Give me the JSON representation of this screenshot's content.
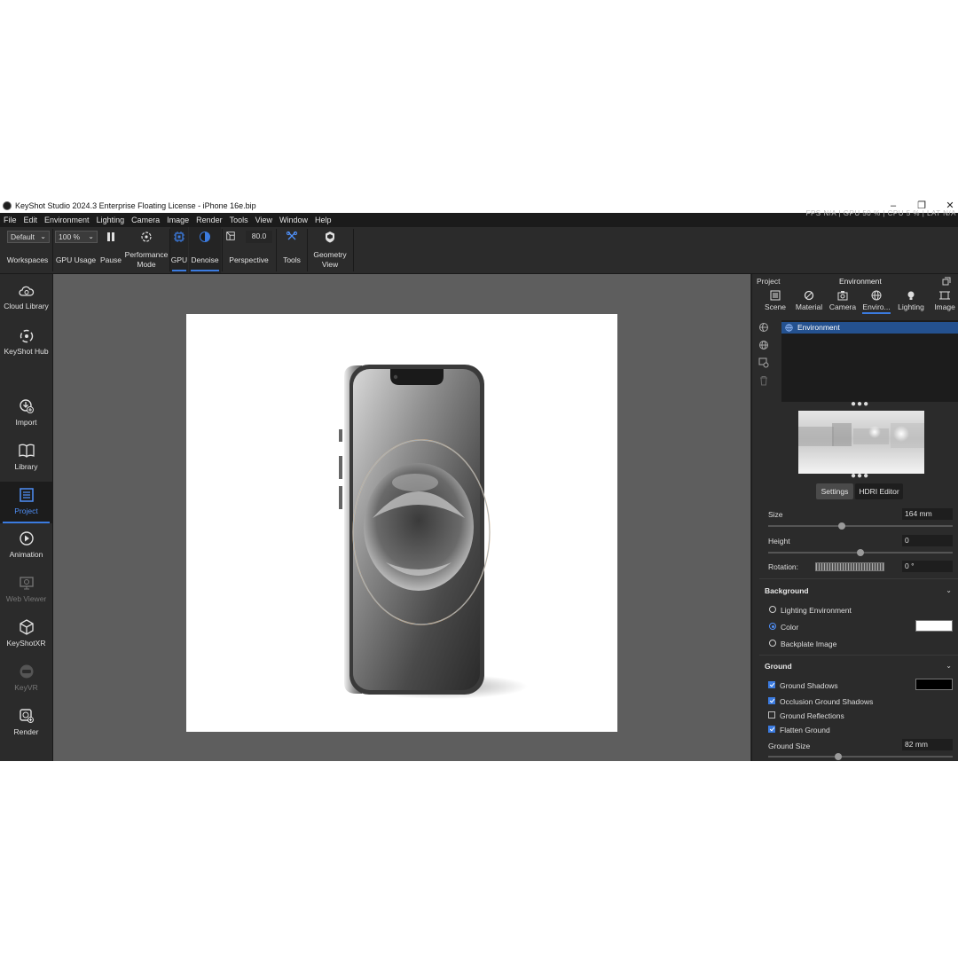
{
  "window": {
    "title": "KeyShot Studio 2024.3 Enterprise Floating License  - iPhone 16e.bip",
    "minimize": "–",
    "restore": "❐",
    "close": "✕"
  },
  "menu": [
    "File",
    "Edit",
    "Environment",
    "Lighting",
    "Camera",
    "Image",
    "Render",
    "Tools",
    "View",
    "Window",
    "Help"
  ],
  "status_text": "FPS N/A  |  GPU 50 %  |  CPU 5 %  |  LAT N/A",
  "toolbar": {
    "workspace_value": "Default",
    "workspaces_label": "Workspaces",
    "gpu_usage_value": "100 %",
    "gpu_usage_label": "GPU Usage",
    "pause_label": "Pause",
    "performance_label": "Performance Mode",
    "gpu_label": "GPU",
    "denoise_label": "Denoise",
    "fov_value": "80.0",
    "perspective_label": "Perspective",
    "tools_label": "Tools",
    "geometry_label": "Geometry View"
  },
  "sidebar": [
    {
      "label": "Cloud Library",
      "icon": "cloud-library-icon"
    },
    {
      "label": "KeyShot Hub",
      "icon": "keyshot-hub-icon"
    },
    {
      "label": "Import",
      "icon": "import-icon"
    },
    {
      "label": "Library",
      "icon": "library-icon"
    },
    {
      "label": "Project",
      "icon": "project-icon"
    },
    {
      "label": "Animation",
      "icon": "animation-icon"
    },
    {
      "label": "Web Viewer",
      "icon": "web-viewer-icon"
    },
    {
      "label": "KeyShotXR",
      "icon": "keyshotxr-icon"
    },
    {
      "label": "KeyVR",
      "icon": "keyvr-icon"
    },
    {
      "label": "Render",
      "icon": "render-icon"
    }
  ],
  "panel": {
    "project_label": "Project",
    "title": "Environment",
    "tabs": [
      "Scene",
      "Material",
      "Camera",
      "Enviro...",
      "Lighting",
      "Image"
    ],
    "env_item": "Environment",
    "settings_tab": "Settings",
    "hdri_tab": "HDRI Editor",
    "size_label": "Size",
    "size_value": "164 mm",
    "height_label": "Height",
    "height_value": "0",
    "rotation_label": "Rotation:",
    "rotation_value": "0 °",
    "background_title": "Background",
    "bg_options": [
      "Lighting Environment",
      "Color",
      "Backplate Image"
    ],
    "bg_color": "#ffffff",
    "ground_title": "Ground",
    "ground_options": [
      {
        "label": "Ground Shadows",
        "checked": true
      },
      {
        "label": "Occlusion Ground Shadows",
        "checked": true
      },
      {
        "label": "Ground Reflections",
        "checked": false
      },
      {
        "label": "Flatten Ground",
        "checked": true
      }
    ],
    "shadow_color": "#000000",
    "ground_size_label": "Ground Size",
    "ground_size_value": "82 mm",
    "size_slider_fraction": 0.4,
    "height_slider_fraction": 0.5,
    "ground_slider_fraction": 0.38
  },
  "accent_color": "#3b7be0"
}
